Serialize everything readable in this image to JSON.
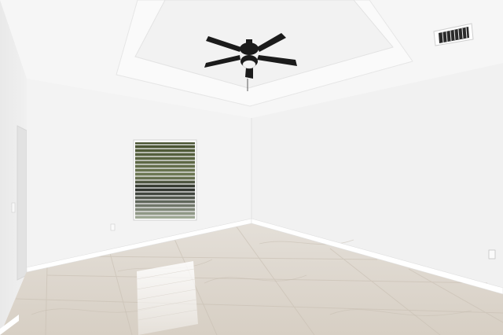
{
  "scene": {
    "description_text": "",
    "colors": {
      "wall_left": "#eeeeee",
      "wall_back": "#f4f4f4",
      "wall_right": "#f2f2f2",
      "ceiling": "#f7f7f7",
      "tray": "#fbfbfb",
      "floor_base": "#ddd6cc",
      "baseboard": "#ffffff",
      "fan": "#1b1b1b",
      "vent": "#2a2a2a",
      "window_blinds": "#e8e8e8",
      "window_view_top": "#3f4a2e",
      "window_view_bottom": "#a9b3a0"
    },
    "objects": [
      "ceiling-fan",
      "air-vent",
      "window-with-blinds",
      "tile-floor",
      "doorway",
      "wall-outlet",
      "light-switch"
    ]
  }
}
